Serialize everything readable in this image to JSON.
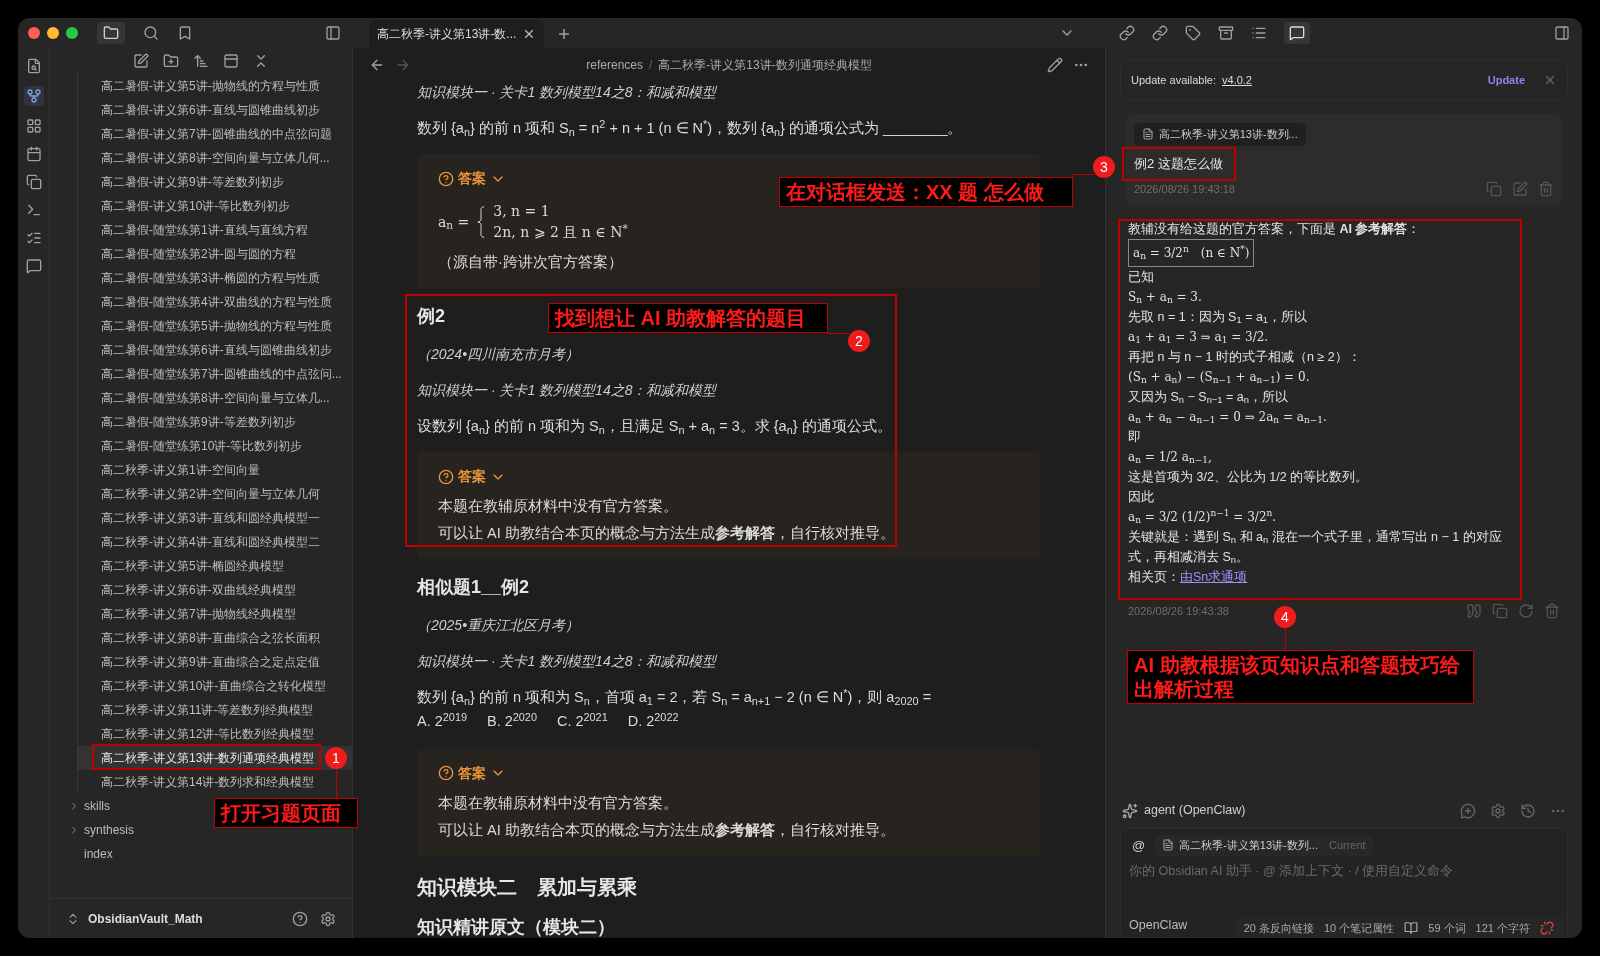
{
  "tab": {
    "title": "高二秋季-讲义第13讲-数...",
    "selected": true
  },
  "sidebar": {
    "files": [
      {
        "label": "高二暑假-讲义第5讲-抛物线的方程与性质",
        "selected": false
      },
      {
        "label": "高二暑假-讲义第6讲-直线与圆锥曲线初步",
        "selected": false
      },
      {
        "label": "高二暑假-讲义第7讲-圆锥曲线的中点弦问题",
        "selected": false
      },
      {
        "label": "高二暑假-讲义第8讲-空间向量与立体几何...",
        "selected": false
      },
      {
        "label": "高二暑假-讲义第9讲-等差数列初步",
        "selected": false
      },
      {
        "label": "高二暑假-讲义第10讲-等比数列初步",
        "selected": false
      },
      {
        "label": "高二暑假-随堂练第1讲-直线与直线方程",
        "selected": false
      },
      {
        "label": "高二暑假-随堂练第2讲-圆与圆的方程",
        "selected": false
      },
      {
        "label": "高二暑假-随堂练第3讲-椭圆的方程与性质",
        "selected": false
      },
      {
        "label": "高二暑假-随堂练第4讲-双曲线的方程与性质",
        "selected": false
      },
      {
        "label": "高二暑假-随堂练第5讲-抛物线的方程与性质",
        "selected": false
      },
      {
        "label": "高二暑假-随堂练第6讲-直线与圆锥曲线初步",
        "selected": false
      },
      {
        "label": "高二暑假-随堂练第7讲-圆锥曲线的中点弦问...",
        "selected": false
      },
      {
        "label": "高二暑假-随堂练第8讲-空间向量与立体几...",
        "selected": false
      },
      {
        "label": "高二暑假-随堂练第9讲-等差数列初步",
        "selected": false
      },
      {
        "label": "高二暑假-随堂练第10讲-等比数列初步",
        "selected": false
      },
      {
        "label": "高二秋季-讲义第1讲-空间向量",
        "selected": false
      },
      {
        "label": "高二秋季-讲义第2讲-空间向量与立体几何",
        "selected": false
      },
      {
        "label": "高二秋季-讲义第3讲-直线和圆经典模型一",
        "selected": false
      },
      {
        "label": "高二秋季-讲义第4讲-直线和圆经典模型二",
        "selected": false
      },
      {
        "label": "高二秋季-讲义第5讲-椭圆经典模型",
        "selected": false
      },
      {
        "label": "高二秋季-讲义第6讲-双曲线经典模型",
        "selected": false
      },
      {
        "label": "高二秋季-讲义第7讲-抛物线经典模型",
        "selected": false
      },
      {
        "label": "高二秋季-讲义第8讲-直曲综合之弦长面积",
        "selected": false
      },
      {
        "label": "高二秋季-讲义第9讲-直曲综合之定点定值",
        "selected": false
      },
      {
        "label": "高二秋季-讲义第10讲-直曲综合之转化模型",
        "selected": false
      },
      {
        "label": "高二秋季-讲义第11讲-等差数列经典模型",
        "selected": false
      },
      {
        "label": "高二秋季-讲义第12讲-等比数列经典模型",
        "selected": false
      },
      {
        "label": "高二秋季-讲义第13讲-数列通项经典模型",
        "selected": true
      },
      {
        "label": "高二秋季-讲义第14讲-数列求和经典模型",
        "selected": false
      }
    ],
    "items": [
      {
        "label": "skills",
        "kind": "folder"
      },
      {
        "label": "synthesis",
        "kind": "folder"
      },
      {
        "label": "index",
        "kind": "file"
      }
    ],
    "vault": "ObsidianVault_Math"
  },
  "breadcrumb": [
    "references",
    "高二秋季-讲义第13讲-数列通项经典模型"
  ],
  "breadcrumb_separator": "/",
  "note": [
    {
      "kind": "module",
      "text": "知识模块一 · 关卡1 数列模型14之8：和减和模型"
    },
    {
      "kind": "paragraph",
      "text": "数列 {a$_{n}$} 的前 n 项和 S$_{n}$ = n$^{2}$ + n + 1 (n ∈ N$^{*}$)，数列 {a$_{n}$} 的通项公式为 ________。"
    },
    {
      "kind": "callout",
      "label": "答案",
      "expanded": true,
      "body": [
        {
          "kind": "cases",
          "lhs": "a$_{n}$ =",
          "cases": [
            "3, n = 1",
            "2n, n ⩾ 2 且 n ∈ N$^{*}$"
          ]
        },
        {
          "kind": "text",
          "text": "（源自带·跨讲次官方答案）"
        }
      ]
    },
    {
      "kind": "heading",
      "text": "例2"
    },
    {
      "kind": "source",
      "text": "（2024•四川南充市月考）"
    },
    {
      "kind": "module",
      "text": "知识模块一 · 关卡1 数列模型14之8：和减和模型"
    },
    {
      "kind": "paragraph",
      "text": "设数列 {a$_{n}$} 的前 n 项和为 S$_{n}$，且满足 S$_{n}$ + a$_{n}$ = 3。求 {a$_{n}$} 的通项公式。"
    },
    {
      "kind": "callout",
      "label": "答案",
      "expanded": true,
      "body": [
        {
          "kind": "text",
          "text": "本题在教辅原材料中没有官方答案。"
        },
        {
          "kind": "text",
          "text": "可以让 AI 助教结合本页的概念与方法生成**参考解答**，自行核对推导。"
        }
      ]
    },
    {
      "kind": "heading",
      "text": "相似题1__例2"
    },
    {
      "kind": "source",
      "text": "（2025•重庆江北区月考）"
    },
    {
      "kind": "module",
      "text": "知识模块一 · 关卡1 数列模型14之8：和减和模型"
    },
    {
      "kind": "paragraph",
      "text": "数列 {a$_{n}$} 的前 n 项和为 S$_{n}$，首项 a$_{1}$ = 2，若 S$_{n}$ = a$_{n+1}$ − 2 (n ∈ N$^{*}$)，则 a$_{2020}$ ="
    },
    {
      "kind": "options",
      "items": [
        "A. 2$^{2019}$",
        "B. 2$^{2020}$",
        "C. 2$^{2021}$",
        "D. 2$^{2022}$"
      ]
    },
    {
      "kind": "callout",
      "label": "答案",
      "expanded": true,
      "body": [
        {
          "kind": "text",
          "text": "本题在教辅原材料中没有官方答案。"
        },
        {
          "kind": "text",
          "text": "可以让 AI 助教结合本页的概念与方法生成**参考解答**，自行核对推导。"
        }
      ]
    },
    {
      "kind": "h2",
      "text": "知识模块二　累加与累乘"
    },
    {
      "kind": "h3",
      "text": "知识精讲原文（模块二）"
    }
  ],
  "chat": {
    "update": {
      "label": "Update available:",
      "version": "v4.0.2",
      "button": "Update"
    },
    "user": {
      "context": "高二秋季-讲义第13讲-数列...",
      "text": "例2 这题怎么做",
      "time": "2026/08/26 19:43:18"
    },
    "answer": {
      "lines": [
        {
          "kind": "text",
          "text": "教辅没有给这题的官方答案，下面是 **AI 参考解答**："
        },
        {
          "kind": "boxed",
          "text": "a$_{n}$ = 3/2$^{n}$　(n ∈ N$^{*}$)"
        },
        {
          "kind": "text",
          "text": "已知"
        },
        {
          "kind": "math",
          "text": "S$_{n}$ + a$_{n}$ = 3."
        },
        {
          "kind": "text",
          "text": "先取 n = 1：因为 S$_{1}$ = a$_{1}$，所以"
        },
        {
          "kind": "math",
          "text": "a$_{1}$ + a$_{1}$ = 3 ⇒ a$_{1}$ = 3/2."
        },
        {
          "kind": "text",
          "text": "再把 n 与 n − 1 时的式子相减（n ≥ 2）："
        },
        {
          "kind": "math",
          "text": "(S$_{n}$ + a$_{n}$) − (S$_{n−1}$ + a$_{n−1}$) = 0."
        },
        {
          "kind": "text",
          "text": "又因为 S$_{n}$ − S$_{n−1}$ = a$_{n}$，所以"
        },
        {
          "kind": "math",
          "text": "a$_{n}$ + a$_{n}$ − a$_{n−1}$ = 0 ⇒ 2a$_{n}$ = a$_{n−1}$."
        },
        {
          "kind": "text",
          "text": "即"
        },
        {
          "kind": "math",
          "text": "a$_{n}$ = 1/2 a$_{n−1}$,"
        },
        {
          "kind": "text",
          "text": "这是首项为 3/2、公比为 1/2 的等比数列。"
        },
        {
          "kind": "text",
          "text": "因此"
        },
        {
          "kind": "math",
          "text": "a$_{n}$ = 3/2 (1/2)$^{n−1}$ = 3/2$^{n}$."
        },
        {
          "kind": "text",
          "text": "关键就是：遇到 S$_{n}$ 和 a$_{n}$ 混在一个式子里，通常写出 n − 1 的对应式，再相减消去 S$_{n}$。"
        }
      ],
      "related_label": "相关页：",
      "related_link": "由Sn求通项",
      "time": "2026/08/26 19:43:38"
    },
    "agent": "agent (OpenClaw)",
    "input": {
      "at": "@",
      "context": "高二秋季-讲义第13讲-数列...",
      "context_tag": "Current",
      "placeholder": "你的 Obsidian AI 助手 · @ 添加上下文 · / 使用自定义命令"
    },
    "provider": "OpenClaw"
  },
  "status_bar": [
    "20 条反向链接",
    "10 个笔记属性",
    "59 个词",
    "121 个字符"
  ],
  "annotations": [
    {
      "number": "1",
      "text": "打开习题页面"
    },
    {
      "number": "2",
      "text": "找到想让 AI 助教解答的题目"
    },
    {
      "number": "3",
      "text": "在对话框发送：XX 题 怎么做"
    },
    {
      "number": "4",
      "text": "AI 助教根据该页知识点和答题技巧给出解析过程"
    }
  ]
}
